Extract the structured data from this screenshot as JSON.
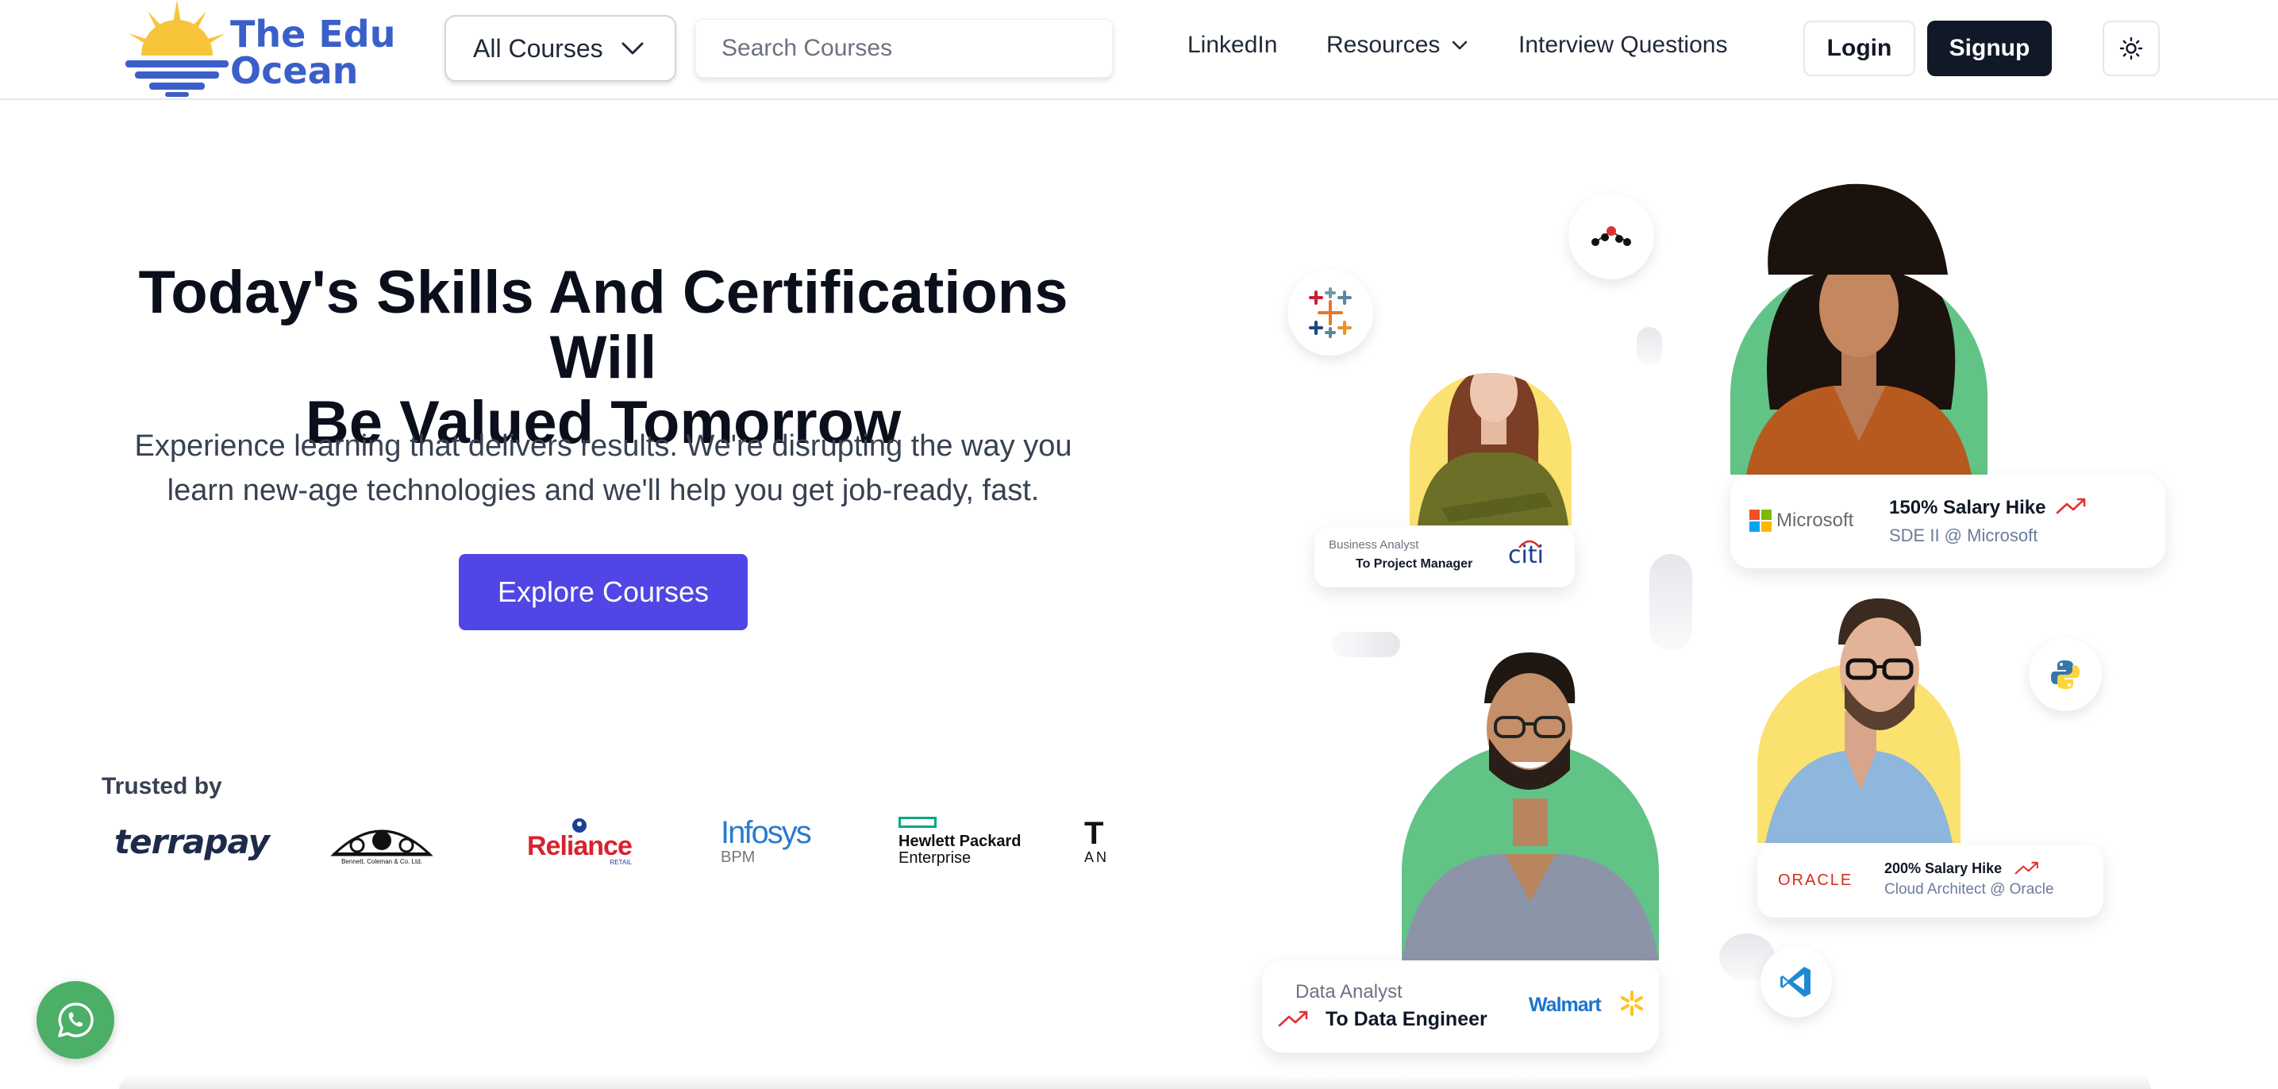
{
  "header": {
    "logo_line1": "The Edu",
    "logo_line2": "Ocean",
    "course_select_value": "All Courses",
    "search_placeholder": "Search Courses",
    "nav": {
      "linkedin": "LinkedIn",
      "resources": "Resources",
      "interview": "Interview Questions"
    },
    "login_label": "Login",
    "signup_label": "Signup",
    "theme_icon": "sun-icon"
  },
  "hero": {
    "title_line1": "Today's Skills And Certifications Will",
    "title_line2": "Be Valued Tomorrow",
    "subtitle_line1": "Experience learning that delivers results. We're disrupting the way you",
    "subtitle_line2": "learn new-age technologies and we'll help you get job-ready, fast.",
    "cta_label": "Explore Courses",
    "accent_color": "#4f46e5"
  },
  "trusted": {
    "label": "Trusted by",
    "brands": [
      {
        "name": "terrapay"
      },
      {
        "name": "Bennett, Coleman & Co. Ltd."
      },
      {
        "name": "Reliance",
        "sub": "RETAIL"
      },
      {
        "name": "Infosys",
        "sub": "BPM"
      },
      {
        "name": "Hewlett Packard",
        "sub": "Enterprise"
      },
      {
        "name": "T",
        "sub": "AN"
      }
    ]
  },
  "cards": {
    "citi": {
      "role_from": "Business Analyst",
      "role_to": "To Project Manager",
      "company": "citi"
    },
    "microsoft": {
      "company": "Microsoft",
      "headline": "150% Salary Hike",
      "role": "SDE II @ Microsoft"
    },
    "oracle": {
      "company": "ORACLE",
      "headline": "200% Salary Hike",
      "role": "Cloud Architect @ Oracle"
    },
    "walmart": {
      "role_from": "Data Analyst",
      "role_to": "To Data Engineer",
      "company": "Walmart"
    }
  },
  "icons": [
    "tableau-icon",
    "nodes-icon",
    "python-icon",
    "vscode-icon",
    "whatsapp-icon"
  ]
}
